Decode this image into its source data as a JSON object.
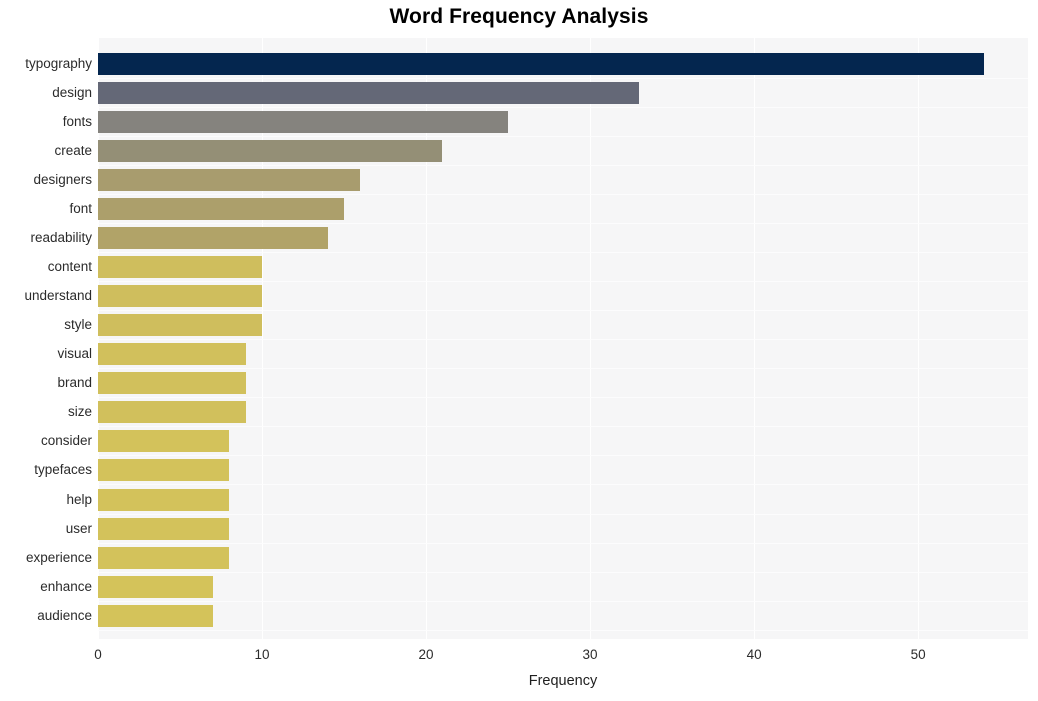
{
  "chart_data": {
    "type": "bar",
    "orientation": "horizontal",
    "title": "Word Frequency Analysis",
    "xlabel": "Frequency",
    "ylabel": "",
    "xlim": [
      0,
      56.7
    ],
    "xticks": [
      0,
      10,
      20,
      30,
      40,
      50
    ],
    "xtick_labels": [
      "0",
      "10",
      "20",
      "30",
      "40",
      "50"
    ],
    "grid": true,
    "grid_axis": "both",
    "legend": false,
    "plot_background": "#f6f6f7",
    "figure_background": "#ffffff",
    "categories": [
      "typography",
      "design",
      "fonts",
      "create",
      "designers",
      "font",
      "readability",
      "content",
      "understand",
      "style",
      "visual",
      "brand",
      "size",
      "consider",
      "typefaces",
      "help",
      "user",
      "experience",
      "enhance",
      "audience"
    ],
    "values": [
      54,
      33,
      25,
      21,
      16,
      15,
      14,
      10,
      10,
      10,
      9,
      9,
      9,
      8,
      8,
      8,
      8,
      8,
      7,
      7
    ],
    "bar_colors": [
      "#04264f",
      "#646877",
      "#85837e",
      "#948f76",
      "#a89c6e",
      "#ac9f6b",
      "#b1a368",
      "#cfbe5d",
      "#cfbe5d",
      "#cfbe5d",
      "#d1c05c",
      "#d1c05c",
      "#d1c05c",
      "#d3c25b",
      "#d3c25b",
      "#d3c25b",
      "#d3c25b",
      "#d3c25b",
      "#d4c35a",
      "#d4c35a"
    ],
    "bars": [
      {
        "label": "typography",
        "value": 54,
        "color": "#04264f"
      },
      {
        "label": "design",
        "value": 33,
        "color": "#646877"
      },
      {
        "label": "fonts",
        "value": 25,
        "color": "#85837e"
      },
      {
        "label": "create",
        "value": 21,
        "color": "#948f76"
      },
      {
        "label": "designers",
        "value": 16,
        "color": "#a89c6e"
      },
      {
        "label": "font",
        "value": 15,
        "color": "#ac9f6b"
      },
      {
        "label": "readability",
        "value": 14,
        "color": "#b1a368"
      },
      {
        "label": "content",
        "value": 10,
        "color": "#cfbe5d"
      },
      {
        "label": "understand",
        "value": 10,
        "color": "#cfbe5d"
      },
      {
        "label": "style",
        "value": 10,
        "color": "#cfbe5d"
      },
      {
        "label": "visual",
        "value": 9,
        "color": "#d1c05c"
      },
      {
        "label": "brand",
        "value": 9,
        "color": "#d1c05c"
      },
      {
        "label": "size",
        "value": 9,
        "color": "#d1c05c"
      },
      {
        "label": "consider",
        "value": 8,
        "color": "#d3c25b"
      },
      {
        "label": "typefaces",
        "value": 8,
        "color": "#d3c25b"
      },
      {
        "label": "help",
        "value": 8,
        "color": "#d3c25b"
      },
      {
        "label": "user",
        "value": 8,
        "color": "#d3c25b"
      },
      {
        "label": "experience",
        "value": 8,
        "color": "#d3c25b"
      },
      {
        "label": "enhance",
        "value": 7,
        "color": "#d4c35a"
      },
      {
        "label": "audience",
        "value": 7,
        "color": "#d4c35a"
      }
    ]
  }
}
